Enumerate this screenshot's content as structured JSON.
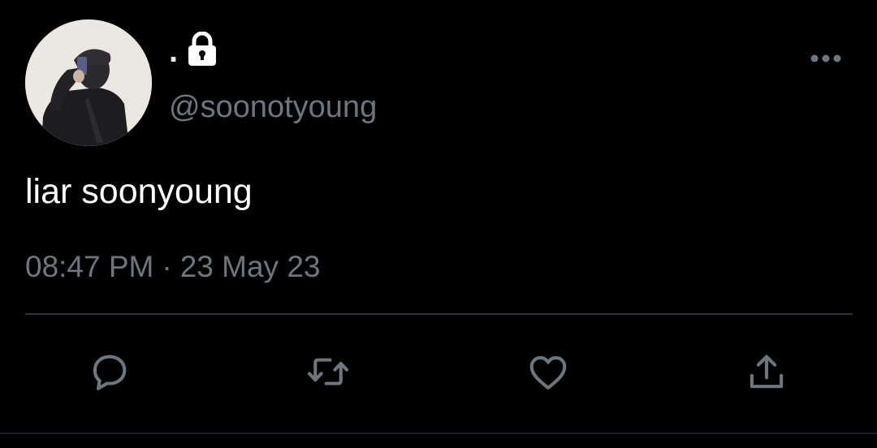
{
  "tweet": {
    "display_name": ".",
    "handle": "@soonotyoung",
    "text": "liar soonyoung",
    "time": "08:47 PM",
    "separator": "·",
    "date": "23 May 23"
  },
  "icons": {
    "protected": "lock-icon",
    "more": "more-horizontal-icon",
    "reply": "reply-icon",
    "retweet": "retweet-icon",
    "like": "heart-icon",
    "share": "share-icon"
  },
  "colors": {
    "background": "#000000",
    "primary_text": "#ffffff",
    "secondary_text": "#6e767d",
    "divider": "#2f3336"
  }
}
